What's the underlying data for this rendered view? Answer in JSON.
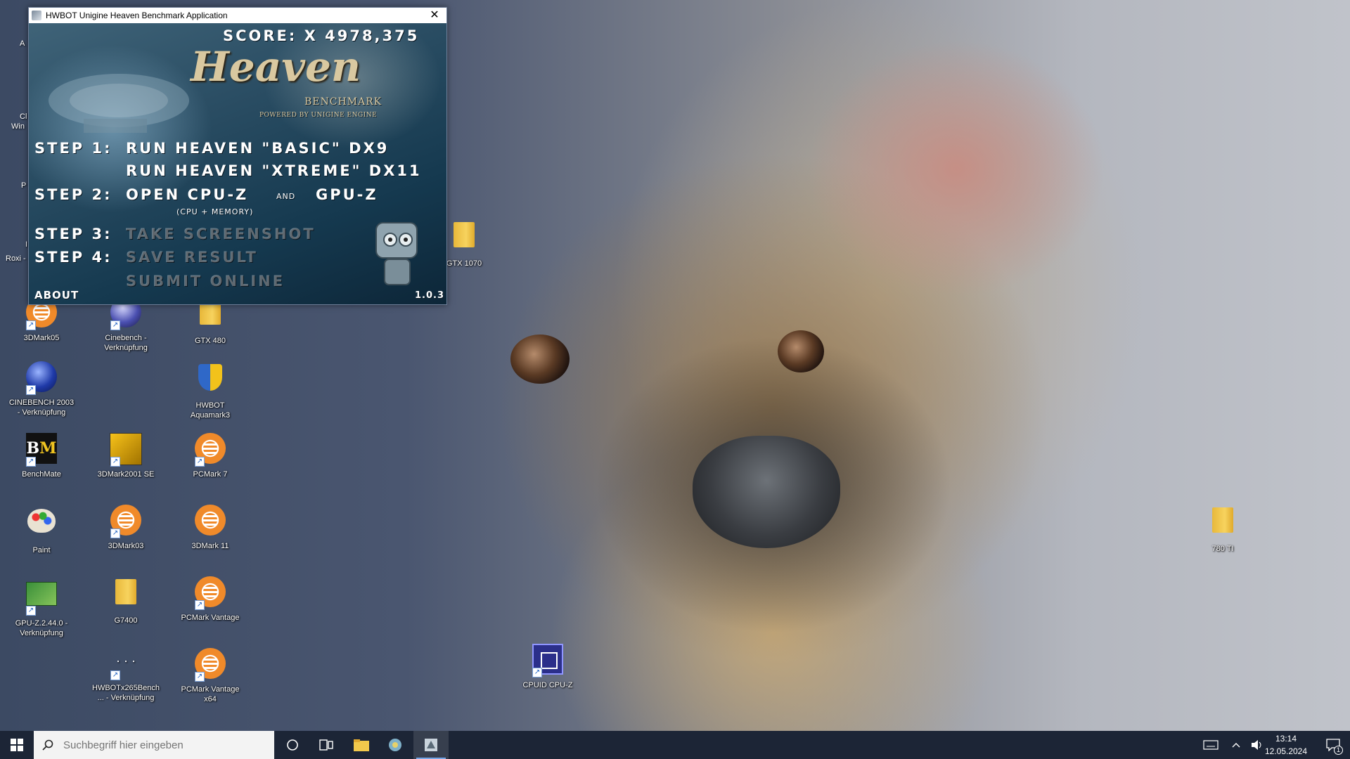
{
  "window": {
    "title": "HWBOT Unigine Heaven Benchmark Application",
    "close_glyph": "✕",
    "score": "SCORE: X 4978,375",
    "logo": "Heaven",
    "logo_sub": "BENCHMARK",
    "logo_powered": "POWERED BY UNIGINE ENGINE",
    "step1_label": "STEP 1:",
    "step1_basic": "RUN HEAVEN \"BASIC\" DX9",
    "step1_xtreme": "RUN HEAVEN \"XTREME\" DX11",
    "step2_label": "STEP 2:",
    "step2_open_cpuz": "OPEN CPU-Z",
    "step2_and": "AND",
    "step2_open_gpuz": "GPU-Z",
    "step2_note": "(CPU + MEMORY)",
    "step3_label": "STEP 3:",
    "step3_action": "TAKE SCREENSHOT",
    "step4_label": "STEP 4:",
    "step4_action": "SAVE RESULT",
    "submit_online": "SUBMIT ONLINE",
    "about": "ABOUT",
    "version": "1.0.3"
  },
  "desktop_icons": [
    {
      "id": "3dmark05",
      "label": "3DMark05",
      "type": "orange"
    },
    {
      "id": "cinebench",
      "label": "Cinebench - Verknüpfung",
      "type": "sphere"
    },
    {
      "id": "gtx480",
      "label": "GTX 480",
      "type": "folder"
    },
    {
      "id": "cinebench2003",
      "label": "CINEBENCH 2003 - Verknüpfung",
      "type": "sphere"
    },
    {
      "id": "aquamark",
      "label": "HWBOT Aquamark3",
      "type": "shield"
    },
    {
      "id": "benchmate",
      "label": "BenchMate",
      "type": "bm"
    },
    {
      "id": "3dmark2001",
      "label": "3DMark2001 SE",
      "type": "yellow"
    },
    {
      "id": "pcmark7",
      "label": "PCMark 7",
      "type": "orange"
    },
    {
      "id": "paint",
      "label": "Paint",
      "type": "paint"
    },
    {
      "id": "3dmark03",
      "label": "3DMark03",
      "type": "orange"
    },
    {
      "id": "3dmark11",
      "label": "3DMark 11",
      "type": "orange"
    },
    {
      "id": "gpuz",
      "label": "GPU-Z.2.44.0 - Verknüpfung",
      "type": "gpuz"
    },
    {
      "id": "g7400",
      "label": "G7400",
      "type": "folder"
    },
    {
      "id": "pcmarkvantage",
      "label": "PCMark Vantage",
      "type": "orange"
    },
    {
      "id": "x265",
      "label": "HWBOTx265Bench... - Verknüpfung",
      "type": "dots"
    },
    {
      "id": "pcmarkvantage64",
      "label": "PCMark Vantage x64",
      "type": "orange"
    },
    {
      "id": "gtx1070",
      "label": "GTX 1070",
      "type": "folder"
    },
    {
      "id": "cpuz",
      "label": "CPUID CPU-Z",
      "type": "cpuz"
    },
    {
      "id": "780ti",
      "label": "780 TI",
      "type": "folder"
    }
  ],
  "partial_icons": [
    "A",
    "Cl",
    "Win",
    "P",
    "I",
    "Roxi -"
  ],
  "taskbar": {
    "search_placeholder": "Suchbegriff hier eingeben",
    "time": "13:14",
    "date": "12.05.2024",
    "notification_count": "1"
  },
  "icons": {
    "start": "windows-logo",
    "search": "magnifier",
    "cortana": "circle",
    "taskview": "task-view",
    "explorer": "folder",
    "app2": "gear-app",
    "app3": "heaven-app",
    "keyboard": "keyboard",
    "chevron": "caret-up",
    "volume": "speaker",
    "notifications": "speech-bubble"
  }
}
